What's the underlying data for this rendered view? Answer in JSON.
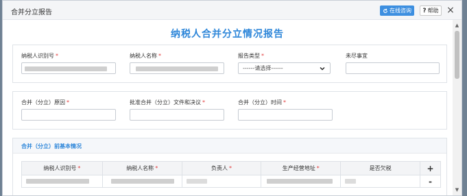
{
  "window": {
    "title": "合并分立报告",
    "consult_label": "在线咨询",
    "help_label": "帮助",
    "close_glyph": "×"
  },
  "report": {
    "title": "纳税人合并分立情况报告"
  },
  "form": {
    "taxpayer_id_label": "纳税人识别号",
    "taxpayer_name_label": "纳税人名称",
    "report_type_label": "报告类型",
    "report_type_value": "------请选择------",
    "pending_label": "未尽事宜",
    "reason_label": "合并（分立）原因",
    "approval_doc_label": "批准合并（分立）文件和决议",
    "time_label": "合并（分立）时间",
    "required_mark": "*"
  },
  "section": {
    "title": "合并（分立）前基本情况",
    "columns": [
      "纳税人识别号",
      "纳税人名称",
      "负责人",
      "生产经营地址",
      "是否欠税"
    ],
    "add_glyph": "+",
    "remove_glyph": "-"
  }
}
